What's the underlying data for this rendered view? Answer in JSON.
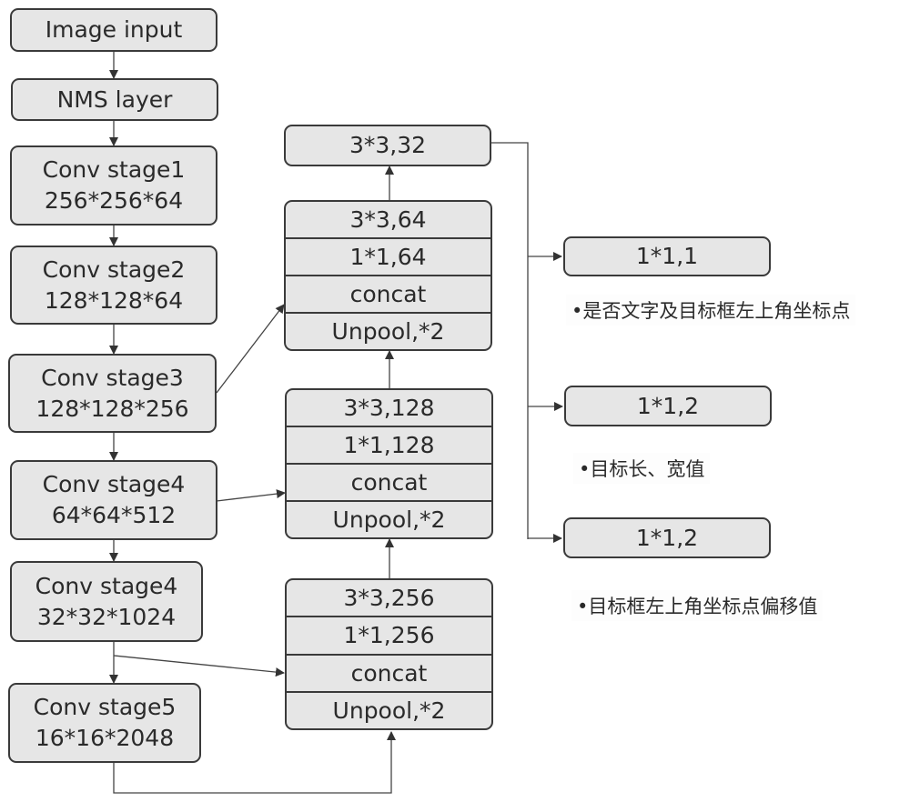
{
  "diagram": {
    "encoder": [
      {
        "id": "image-input",
        "lines": [
          "Image input"
        ]
      },
      {
        "id": "nms-layer",
        "lines": [
          "NMS layer"
        ]
      },
      {
        "id": "conv-stage1",
        "lines": [
          "Conv stage1",
          "256*256*64"
        ]
      },
      {
        "id": "conv-stage2",
        "lines": [
          "Conv stage2",
          "128*128*64"
        ]
      },
      {
        "id": "conv-stage3",
        "lines": [
          "Conv stage3",
          "128*128*256"
        ]
      },
      {
        "id": "conv-stage4a",
        "lines": [
          "Conv stage4",
          "64*64*512"
        ]
      },
      {
        "id": "conv-stage4b",
        "lines": [
          "Conv stage4",
          "32*32*1024"
        ]
      },
      {
        "id": "conv-stage5",
        "lines": [
          "Conv stage5",
          "16*16*2048"
        ]
      }
    ],
    "decoder": [
      {
        "id": "merge-block-3",
        "cells": [
          "3*3,256",
          "1*1,256",
          "concat",
          "Unpool,*2"
        ]
      },
      {
        "id": "merge-block-2",
        "cells": [
          "3*3,128",
          "1*1,128",
          "concat",
          "Unpool,*2"
        ]
      },
      {
        "id": "merge-block-1",
        "cells": [
          "3*3,64",
          "1*1,64",
          "concat",
          "Unpool,*2"
        ]
      }
    ],
    "final_conv": {
      "id": "final-conv",
      "label": "3*3,32"
    },
    "outputs": [
      {
        "id": "output-score",
        "label": "1*1,1",
        "note": "•是否文字及目标框左上角坐标点"
      },
      {
        "id": "output-size",
        "label": "1*1,2",
        "note": "•目标长、宽值"
      },
      {
        "id": "output-offset",
        "label": "1*1,2",
        "note": "•目标框左上角坐标点偏移值"
      }
    ],
    "edges": [
      {
        "from": "image-input",
        "to": "nms-layer"
      },
      {
        "from": "nms-layer",
        "to": "conv-stage1"
      },
      {
        "from": "conv-stage1",
        "to": "conv-stage2"
      },
      {
        "from": "conv-stage2",
        "to": "conv-stage3"
      },
      {
        "from": "conv-stage3",
        "to": "conv-stage4a"
      },
      {
        "from": "conv-stage4a",
        "to": "conv-stage4b"
      },
      {
        "from": "conv-stage4b",
        "to": "conv-stage5"
      },
      {
        "from": "conv-stage5",
        "to": "merge-block-3"
      },
      {
        "from": "conv-stage4b",
        "to": "merge-block-3"
      },
      {
        "from": "merge-block-3",
        "to": "merge-block-2"
      },
      {
        "from": "conv-stage4a",
        "to": "merge-block-2"
      },
      {
        "from": "merge-block-2",
        "to": "merge-block-1"
      },
      {
        "from": "conv-stage3",
        "to": "merge-block-1"
      },
      {
        "from": "merge-block-1",
        "to": "final-conv"
      },
      {
        "from": "final-conv",
        "to": "output-score"
      },
      {
        "from": "final-conv",
        "to": "output-size"
      },
      {
        "from": "final-conv",
        "to": "output-offset"
      }
    ]
  }
}
